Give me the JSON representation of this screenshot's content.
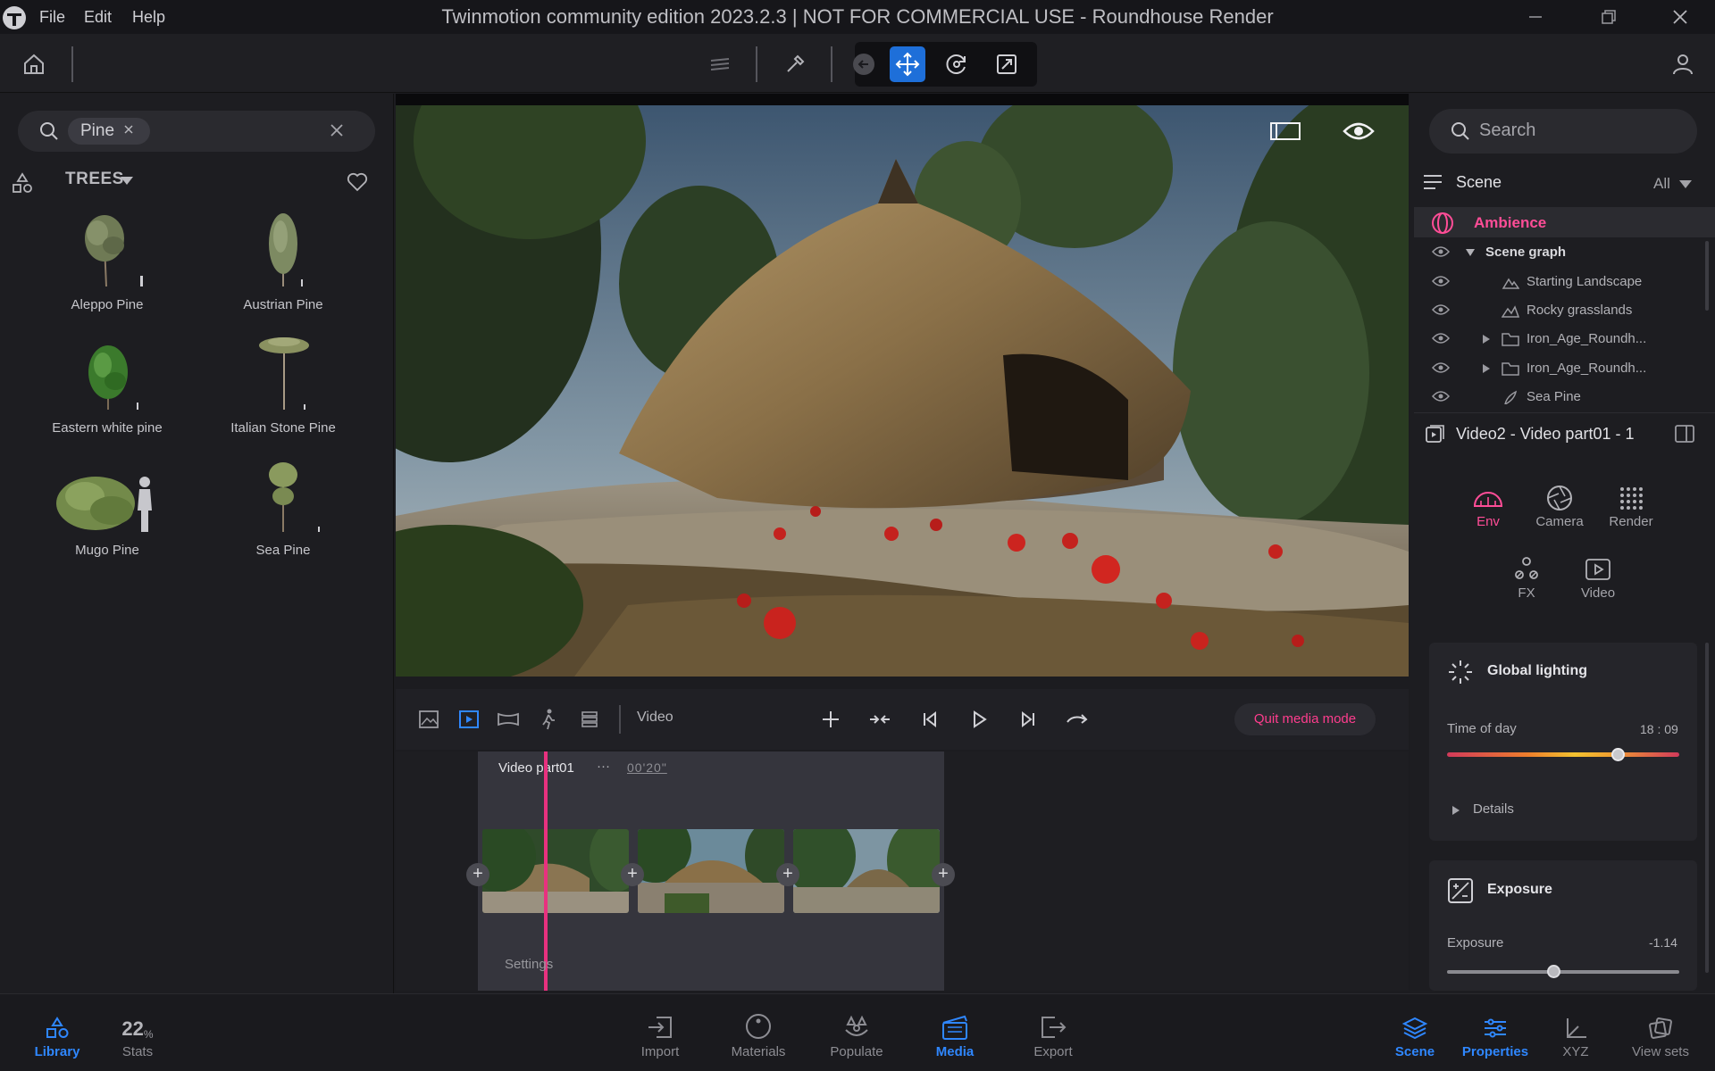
{
  "window": {
    "title": "Twinmotion community edition 2023.2.3 | NOT FOR COMMERCIAL USE - Roundhouse Render",
    "menu": [
      "File",
      "Edit",
      "Help"
    ]
  },
  "library": {
    "search_chip": "Pine",
    "category": "TREES",
    "items": [
      {
        "label": "Aleppo Pine"
      },
      {
        "label": "Austrian Pine"
      },
      {
        "label": "Eastern white pine"
      },
      {
        "label": "Italian Stone Pine"
      },
      {
        "label": "Mugo Pine"
      },
      {
        "label": "Sea Pine"
      }
    ]
  },
  "mediabar": {
    "video_label": "Video",
    "quit_label": "Quit media mode"
  },
  "timeline": {
    "clip_title": "Video part01",
    "more": "···",
    "duration": "00'20\"",
    "settings_label": "Settings"
  },
  "right": {
    "search_placeholder": "Search",
    "scene_title": "Scene",
    "scene_filter": "All",
    "ambience": "Ambience",
    "scene_graph": [
      {
        "label": "Scene graph",
        "icon": "caret-down-icon"
      },
      {
        "label": "Starting Landscape",
        "icon": "landscape-icon"
      },
      {
        "label": "Rocky grasslands",
        "icon": "terrain-icon"
      },
      {
        "label": "Iron_Age_Roundh...",
        "icon": "folder-icon"
      },
      {
        "label": "Iron_Age_Roundh...",
        "icon": "folder-icon"
      },
      {
        "label": "Sea Pine",
        "icon": "plant-icon"
      }
    ],
    "props_title": "Video2 - Video part01 - 1",
    "tabs": [
      {
        "label": "Env",
        "icon": "env-icon",
        "active": true
      },
      {
        "label": "Camera",
        "icon": "aperture-icon"
      },
      {
        "label": "Render",
        "icon": "dots-grid-icon"
      },
      {
        "label": "FX",
        "icon": "fx-icon"
      },
      {
        "label": "Video",
        "icon": "video-icon"
      }
    ],
    "global_lighting": {
      "title": "Global lighting",
      "time_label": "Time of day",
      "time_value": "18 : 09",
      "time_fraction": 0.74,
      "details": "Details"
    },
    "exposure": {
      "title": "Exposure",
      "label": "Exposure",
      "value": "-1.14",
      "fraction": 0.46
    }
  },
  "bottombar": {
    "library": "Library",
    "stats_value": "22",
    "stats_unit": "%",
    "stats": "Stats",
    "import": "Import",
    "materials": "Materials",
    "populate": "Populate",
    "media": "Media",
    "export": "Export",
    "scene": "Scene",
    "properties": "Properties",
    "xyz": "XYZ",
    "view_sets": "View sets"
  },
  "colors": {
    "accent_blue": "#2f87ff",
    "accent_pink": "#ff4d97",
    "tool_active": "#1e6fd9"
  }
}
